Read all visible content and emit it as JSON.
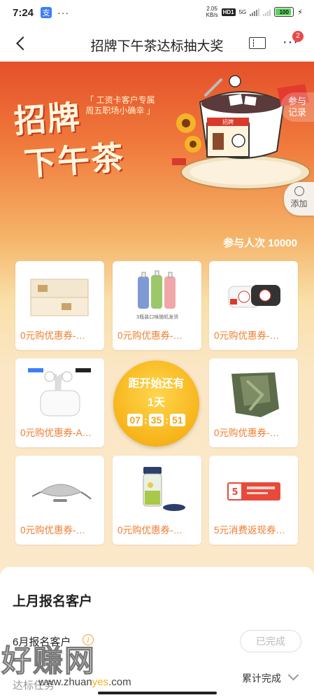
{
  "status_bar": {
    "time": "7:24",
    "app_badge": "支",
    "dots": "···",
    "net_speed": "2.05",
    "net_unit": "KB/s",
    "hd": "HD1",
    "signal": "5G",
    "battery": "100"
  },
  "nav": {
    "title": "招牌下午茶达标抽大奖",
    "more": "···",
    "badge": "2"
  },
  "banner": {
    "title_line1": "招牌",
    "title_line2": "下午茶",
    "tag_line1": "「 工资卡客户专属",
    "tag_line2": "周五职场小确幸 」",
    "shop_sign": "招牌",
    "record_label_1": "参与",
    "record_label_2": "记录",
    "add_label": "添加",
    "participants": "参与人次 10000"
  },
  "prizes": [
    {
      "label": "0元购优惠券-…",
      "icon": "tissue-pack-icon"
    },
    {
      "label": "0元购优惠券-…",
      "icon": "drink-bottles-icon"
    },
    {
      "label": "0元购优惠券-…",
      "icon": "pillow-icon"
    },
    {
      "label": "0元购优惠券-A…",
      "icon": "earbuds-icon"
    },
    {
      "label": "0元购优惠券-…",
      "icon": "blanket-icon"
    },
    {
      "label": "0元购优惠券-…",
      "icon": "eye-mask-icon"
    },
    {
      "label": "0元购优惠券-…",
      "icon": "blender-icon"
    },
    {
      "label": "5元消费返现券…",
      "icon": "cashback-coupon-icon"
    }
  ],
  "drink_caption": "3瓶装口味随机发货",
  "coupon_value": "5",
  "countdown": {
    "title": "距开始还有",
    "days": "1天",
    "hh": "07",
    "mm": "35",
    "ss": "51"
  },
  "panel": {
    "section_title": "上月报名客户",
    "month_label": "6月报名客户",
    "info": "i",
    "done": "已完成",
    "cumulative": "累计完成",
    "partial_text": "达标任务"
  },
  "watermark": {
    "text": "好赚网",
    "url_prefix": "www.zhuan",
    "url_accent": "yes",
    "url_suffix": ".com"
  }
}
